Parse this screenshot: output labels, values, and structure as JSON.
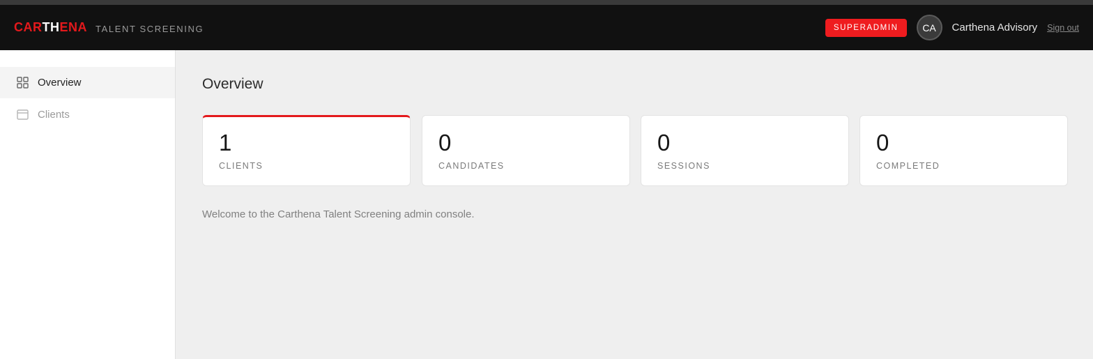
{
  "header": {
    "logo": {
      "part1": "CAR",
      "part2": "TH",
      "part3": "ENA"
    },
    "subtitle": "TALENT SCREENING",
    "role_badge": "SUPERADMIN",
    "avatar_initials": "CA",
    "user_name": "Carthena Advisory",
    "signout_label": "Sign out"
  },
  "sidebar": {
    "items": [
      {
        "label": "Overview",
        "icon": "grid-icon",
        "active": true
      },
      {
        "label": "Clients",
        "icon": "window-icon",
        "active": false
      }
    ]
  },
  "main": {
    "title": "Overview",
    "stats": [
      {
        "value": "1",
        "label": "CLIENTS"
      },
      {
        "value": "0",
        "label": "CANDIDATES"
      },
      {
        "value": "0",
        "label": "SESSIONS"
      },
      {
        "value": "0",
        "label": "COMPLETED"
      }
    ],
    "welcome_text": "Welcome to the Carthena Talent Screening admin console."
  },
  "colors": {
    "brand_red": "#e3191c",
    "badge_red": "#ef1c1f",
    "header_bg": "#111111",
    "page_bg": "#efefef"
  }
}
